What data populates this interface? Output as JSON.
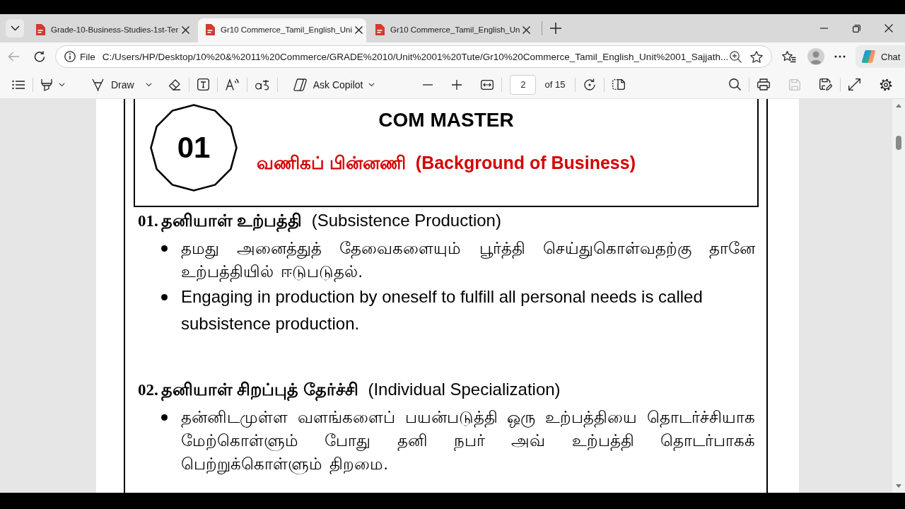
{
  "tab_strip": {
    "tabs": [
      {
        "title": "Grade-10-Business-Studies-1st-Ter",
        "selected": false
      },
      {
        "title": "Gr10 Commerce_Tamil_English_Uni",
        "selected": true
      },
      {
        "title": "Gr10 Commerce_Tamil_English_Un",
        "selected": false
      }
    ]
  },
  "address_bar": {
    "back_disabled": true,
    "scheme": "File",
    "url": "C:/Users/HP/Desktop/10%20&%2011%20Commerce/GRADE%2010/Unit%2001%20Tute/Gr10%20Commerce_Tamil_English_Unit%2001_Sajjath...",
    "chat_label": "Chat"
  },
  "pdf_toolbar": {
    "draw_label": "Draw",
    "copilot_label": "Ask Copilot",
    "page_number": "2",
    "page_count": "of 15",
    "save_disabled": true
  },
  "document": {
    "header": {
      "unit_number": "01",
      "title": "COM MASTER",
      "subtitle": "வணிகப் பின்னணி  (Background of Business)"
    },
    "sections": [
      {
        "number": "01.",
        "heading": "**தனியாள் உற்பத்தி**  (Subsistence Production)",
        "bullets": [
          {
            "kind": "tamil",
            "text": "தமது அனைத்துத் தேவைகளையும் பூர்த்தி செய்துகொள்வதற்கு தானே உற்பத்தியில் ஈடுபடுதல்."
          },
          {
            "kind": "english",
            "text": "Engaging in production by oneself to fulfill all personal needs is called subsistence production."
          }
        ]
      },
      {
        "number": "02.",
        "heading": "**தனியாள் சிறப்புத் தேர்ச்சி**  (Individual Specialization)",
        "bullets": [
          {
            "kind": "tamil",
            "text": "தன்னிடமுள்ள வளங்களைப் பயன்படுத்தி ஒரு உற்பத்தியை தொடர்ச்சியாக மேற்கொள்ளும் போது தனி நபர் அவ் உற்பத்தி தொடர்பாகக் பெற்றுக்கொள்ளும் திறமை."
          }
        ]
      }
    ]
  }
}
